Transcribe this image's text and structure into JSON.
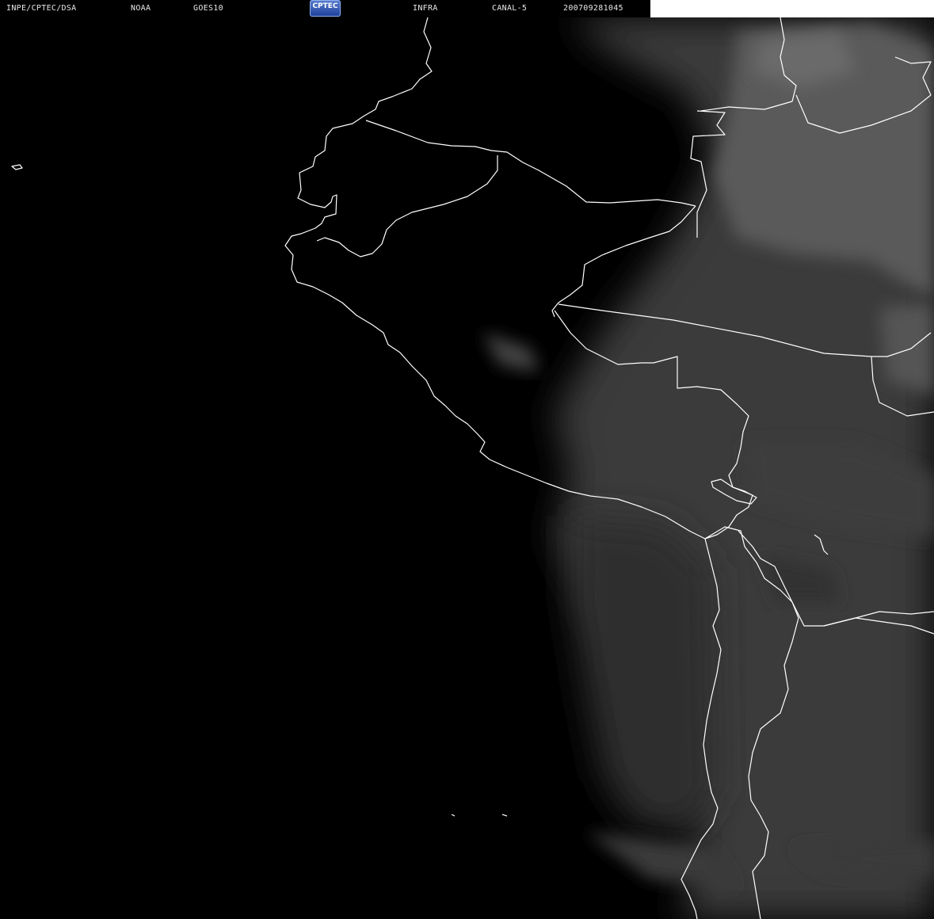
{
  "header": {
    "institution": "INPE/CPTEC/DSA",
    "agency": "NOAA",
    "satellite": "GOES10",
    "logo_text": "CPTEC",
    "product": "INFRA",
    "channel": "CANAL-5",
    "timestamp": "200709281045"
  },
  "colors": {
    "background": "#000000",
    "coastline": "#ffffff",
    "cloud_gray": "#5a5a5a",
    "header_blank": "#ffffff"
  }
}
